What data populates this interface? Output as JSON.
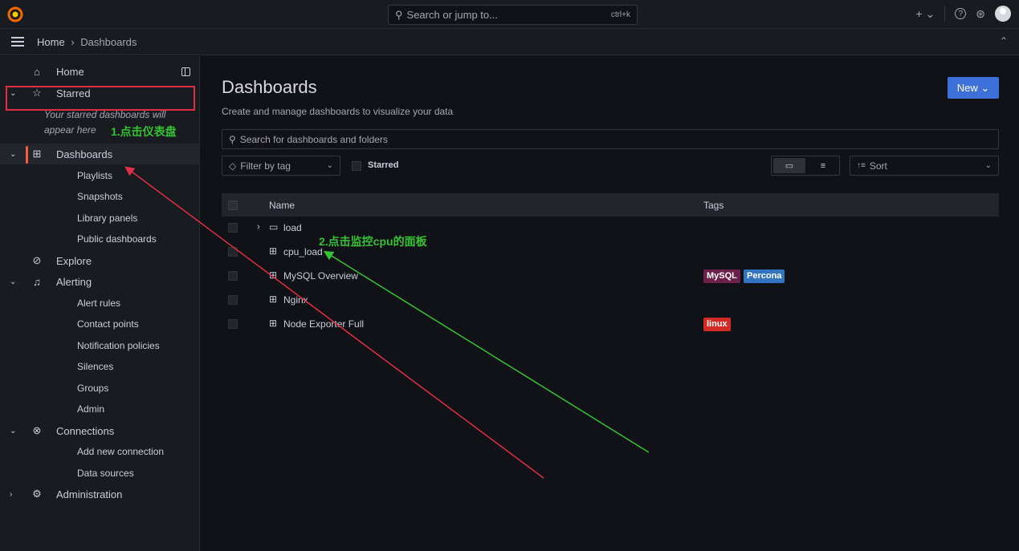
{
  "topbar": {
    "search_placeholder": "Search or jump to...",
    "search_shortcut": "ctrl+k",
    "plus": "+ ⌄",
    "help": "?",
    "news": "⊛"
  },
  "breadcrumb": {
    "home": "Home",
    "separator": "›",
    "current": "Dashboards"
  },
  "sidebar": {
    "items": [
      {
        "label": "Home",
        "icon": "home-icon"
      },
      {
        "label": "Starred",
        "icon": "star-icon"
      },
      {
        "label": "Dashboards",
        "icon": "grid-icon"
      },
      {
        "label": "Playlists"
      },
      {
        "label": "Snapshots"
      },
      {
        "label": "Library panels"
      },
      {
        "label": "Public dashboards"
      },
      {
        "label": "Explore",
        "icon": "compass-icon"
      },
      {
        "label": "Alerting",
        "icon": "bell-icon"
      },
      {
        "label": "Alert rules"
      },
      {
        "label": "Contact points"
      },
      {
        "label": "Notification policies"
      },
      {
        "label": "Silences"
      },
      {
        "label": "Groups"
      },
      {
        "label": "Admin"
      },
      {
        "label": "Connections",
        "icon": "link-icon"
      },
      {
        "label": "Add new connection"
      },
      {
        "label": "Data sources"
      },
      {
        "label": "Administration",
        "icon": "cog-icon"
      }
    ],
    "starred_hint_1": "Your starred dashboards will",
    "starred_hint_2": "appear here"
  },
  "main": {
    "title": "Dashboards",
    "subtitle": "Create and manage dashboards to visualize your data",
    "new_button": "New ⌄",
    "search_placeholder": "Search for dashboards and folders",
    "filter_placeholder": "Filter by tag",
    "starred_label": "Starred",
    "sort_label": "Sort",
    "table_headers": {
      "name": "Name",
      "tags": "Tags"
    },
    "rows": [
      {
        "title": "load",
        "type": "folder",
        "tags": []
      },
      {
        "title": "cpu_load",
        "type": "dashboard",
        "tags": []
      },
      {
        "title": "MySQL Overview",
        "type": "dashboard",
        "tags": [
          "MySQL",
          "Percona"
        ]
      },
      {
        "title": "Nginx",
        "type": "dashboard",
        "tags": []
      },
      {
        "title": "Node Exporter Full",
        "type": "dashboard",
        "tags": [
          "linux"
        ]
      }
    ]
  },
  "annotations": {
    "step1": "1.点击仪表盘",
    "step2": "2.点击监控cpu的面板"
  },
  "colors": {
    "accent_orange": "#f55f3e",
    "primary_blue": "#3d71d9",
    "annotation_green": "#36c235",
    "annotation_red": "#e02f44",
    "tag_mysql": "#6e1f4a",
    "tag_percona": "#3274c2",
    "tag_linux": "#d42a24"
  }
}
